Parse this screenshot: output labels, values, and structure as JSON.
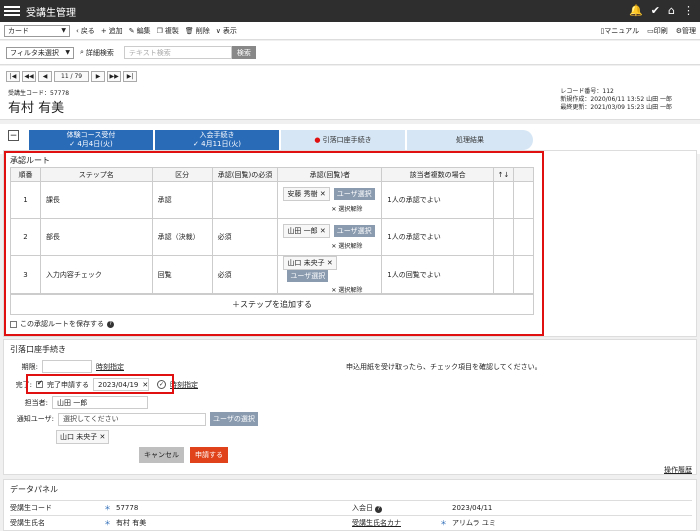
{
  "app": {
    "title": "受講生管理"
  },
  "toolbar": {
    "view_select": "カード",
    "back": "戻る",
    "add": "追加",
    "edit": "編集",
    "copy": "複製",
    "delete": "削除",
    "display": "表示",
    "manual": "マニュアル",
    "print": "印刷",
    "admin": "管理"
  },
  "filter": {
    "select": "フィルタ未選択",
    "advanced": "詳細検索",
    "text_placeholder": "テキスト検索",
    "search_button": "検索"
  },
  "record": {
    "pager": "11 / 79",
    "code_label": "受講生コード：57778",
    "name": "有村 有美",
    "meta": [
      "レコード番号：112",
      "新規作成：2020/06/11 13:52 山田 一郎",
      "最終更新：2021/03/09 15:23 山田 一郎"
    ]
  },
  "steps": [
    {
      "label": "体験コース受付",
      "date": "✓ 4月4日(火)"
    },
    {
      "label": "入会手続き",
      "date": "✓ 4月11日(火)"
    },
    {
      "label": "引落口座手続き",
      "date": ""
    },
    {
      "label": "処理結果",
      "date": ""
    }
  ],
  "route": {
    "title": "承認ルート",
    "headers": [
      "順番",
      "ステップ名",
      "区分",
      "承認(回覧)の必須",
      "承認(回覧)者",
      "該当者複数の場合",
      "↑↓"
    ],
    "rows": [
      {
        "no": "1",
        "name": "課長",
        "type": "承認",
        "required": "",
        "person": "安藤 秀樹",
        "multi": "1人の承認でよい"
      },
      {
        "no": "2",
        "name": "部長",
        "type": "承認（決裁）",
        "required": "必須",
        "person": "山田 一郎",
        "multi": "1人の承認でよい"
      },
      {
        "no": "3",
        "name": "入力内容チェック",
        "type": "回覧",
        "required": "必須",
        "person": "山口 未央子",
        "multi": "1人の回覧でよい"
      }
    ],
    "user_select": "ユーザ選択",
    "clear": "✕ 選択解除",
    "add_step": "＋ステップを追加する",
    "save_route": "この承認ルートを保存する"
  },
  "debit": {
    "title": "引落口座手続き",
    "deadline_label": "期限:",
    "specify": "時刻指定",
    "instruction": "申込用紙を受け取ったら、チェック項目を確認してください。",
    "done_label": "完了:",
    "apply_done": "完了申請する",
    "done_date": "2023/04/19",
    "assignee_label": "担当者:",
    "assignee": "山田 一郎",
    "notify_label": "通知ユーザ:",
    "notify_placeholder": "選択してください",
    "user_select": "ユーザの選択",
    "notify_user": "山口 未央子",
    "cancel": "キャンセル",
    "apply": "申請する",
    "history": "操作履歴"
  },
  "datapanel": {
    "title": "データパネル",
    "rows": [
      {
        "l1": "受講生コード",
        "v1": "57778",
        "l2": "入会日",
        "v2": "2023/04/11"
      },
      {
        "l1": "受講生氏名",
        "v1": "有村 有美",
        "l2": "受講生氏名カナ",
        "v2": "アリムラ ユミ"
      }
    ]
  }
}
